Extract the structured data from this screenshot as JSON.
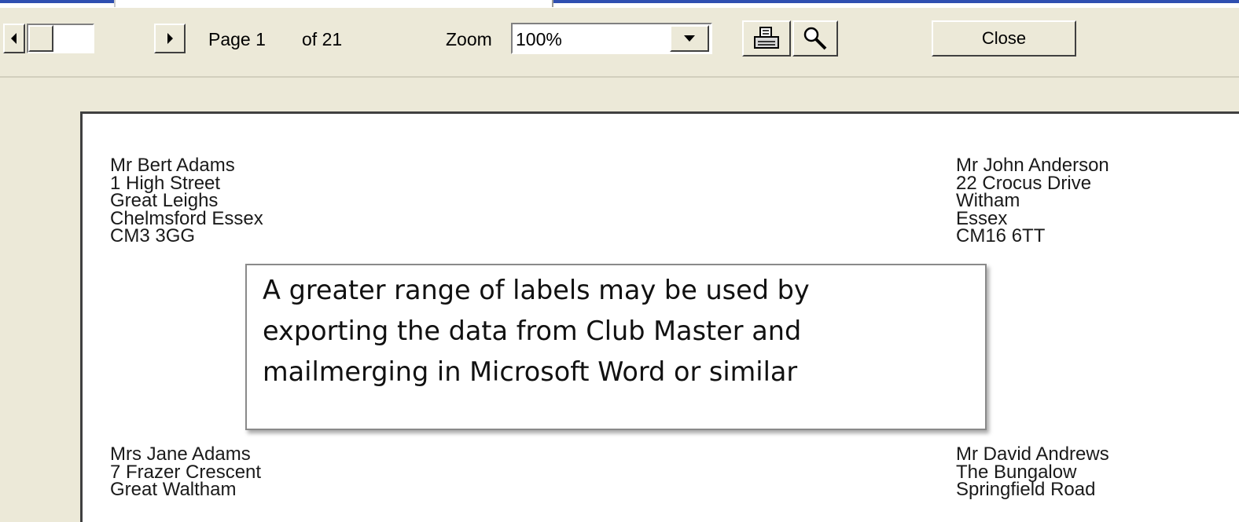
{
  "toolbar": {
    "page_label": "Page 1",
    "of_label": "of 21",
    "zoom_label": "Zoom",
    "zoom_value": "100%",
    "close_label": "Close",
    "icons": [
      "arrow-left-icon",
      "arrow-right-icon",
      "dropdown-arrow-icon",
      "printer-icon",
      "magnifier-icon"
    ]
  },
  "labels": [
    {
      "lines": [
        "Mr Bert Adams",
        "1 High Street",
        "Great Leighs",
        "Chelmsford Essex",
        "CM3 3GG"
      ]
    },
    {
      "lines": [
        "Mr John Anderson",
        "22 Crocus Drive",
        "Witham",
        "Essex",
        "CM16 6TT"
      ]
    },
    {
      "lines": [
        "Mrs Jane Adams",
        "7 Frazer Crescent",
        "Great Waltham"
      ]
    },
    {
      "lines": [
        "Mr David Andrews",
        "The Bungalow",
        "Springfield Road"
      ]
    }
  ],
  "callout": {
    "lines": [
      "A greater range of labels may be used by",
      "exporting the data from Club Master and",
      "mailmerging in Microsoft Word or similar"
    ]
  }
}
